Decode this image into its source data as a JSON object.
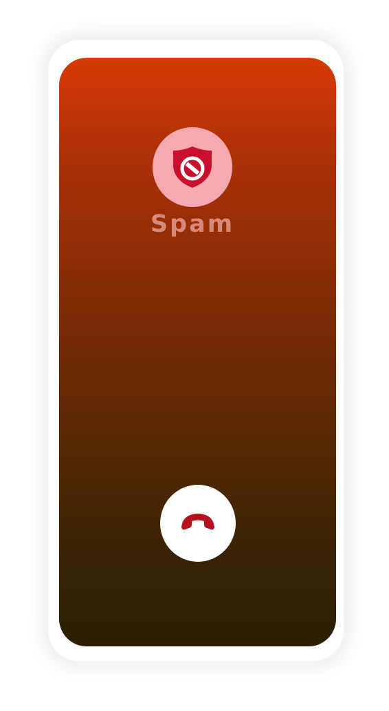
{
  "caller": {
    "label": "Spam",
    "icon": "spam-shield-icon"
  },
  "actions": {
    "end_call_icon": "end-call-phone-icon"
  },
  "colors": {
    "screen_top": "#d73a05",
    "screen_bottom": "#2b2003",
    "avatar_bg": "#f6a9b0",
    "shield": "#c8102e",
    "label": "#d88a7a",
    "end_call_icon": "#b5121b"
  }
}
